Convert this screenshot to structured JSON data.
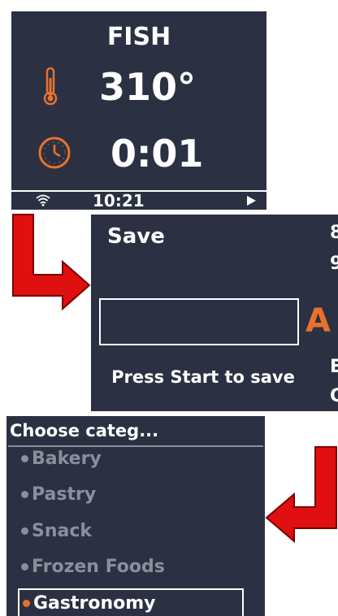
{
  "panel_cook": {
    "program": "FISH",
    "temperature": "310°",
    "timer": "0:01",
    "status_clock": "10:21",
    "icons": [
      "thermometer-icon",
      "clock-icon",
      "wifi-icon",
      "play-icon"
    ]
  },
  "panel_save": {
    "title": "Save",
    "name_value": "",
    "hint": "Press Start to save",
    "edge_chars": [
      "8",
      "9",
      "A",
      "E",
      "C"
    ]
  },
  "panel_category": {
    "title": "Choose categ...",
    "items": [
      {
        "label": "Bakery",
        "selected": false
      },
      {
        "label": "Pastry",
        "selected": false
      },
      {
        "label": "Snack",
        "selected": false
      },
      {
        "label": "Frozen Foods",
        "selected": false
      },
      {
        "label": "Gastronomy",
        "selected": true
      }
    ]
  },
  "colors": {
    "panel_bg": "#2b3143",
    "accent": "#e8722c",
    "muted": "#8a8f9c",
    "arrow": "#e01010"
  }
}
